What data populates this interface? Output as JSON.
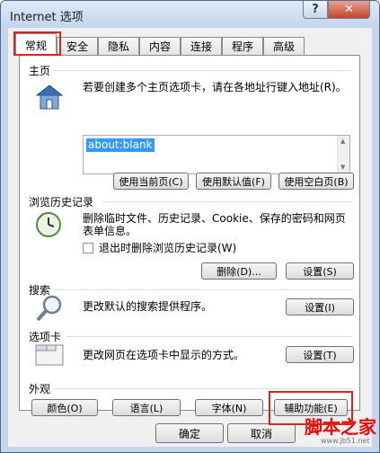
{
  "window": {
    "title": "Internet 选项",
    "help_label": "?",
    "close_label": "✕"
  },
  "tabs": [
    {
      "label": "常规",
      "active": true
    },
    {
      "label": "安全"
    },
    {
      "label": "隐私"
    },
    {
      "label": "内容"
    },
    {
      "label": "连接"
    },
    {
      "label": "程序"
    },
    {
      "label": "高级"
    }
  ],
  "home": {
    "group": "主页",
    "desc": "若要创建多个主页选项卡，请在各地址行键入地址(R)。",
    "url_value": "about:blank",
    "btn_current": "使用当前页(C)",
    "btn_default": "使用默认值(F)",
    "btn_blank": "使用空白页(B)"
  },
  "history": {
    "group": "浏览历史记录",
    "desc_line1": "删除临时文件、历史记录、Cookie、保存的密码和网页",
    "desc_line2": "表单信息。",
    "checkbox_label": "退出时删除浏览历史记录(W)",
    "btn_delete": "删除(D)...",
    "btn_settings": "设置(S)"
  },
  "search": {
    "group": "搜索",
    "desc": "更改默认的搜索提供程序。",
    "btn_settings": "设置(I)"
  },
  "tabs_section": {
    "group": "选项卡",
    "desc": "更改网页在选项卡中显示的方式。",
    "btn_settings": "设置(T)"
  },
  "appearance": {
    "group": "外观",
    "btn_colors": "颜色(O)",
    "btn_languages": "语言(L)",
    "btn_fonts": "字体(N)",
    "btn_accessibility": "辅助功能(E)"
  },
  "bottom": {
    "ok": "确定",
    "cancel": "取消"
  },
  "watermark": {
    "brand": "脚本之家",
    "url": "www.jb51.net"
  }
}
